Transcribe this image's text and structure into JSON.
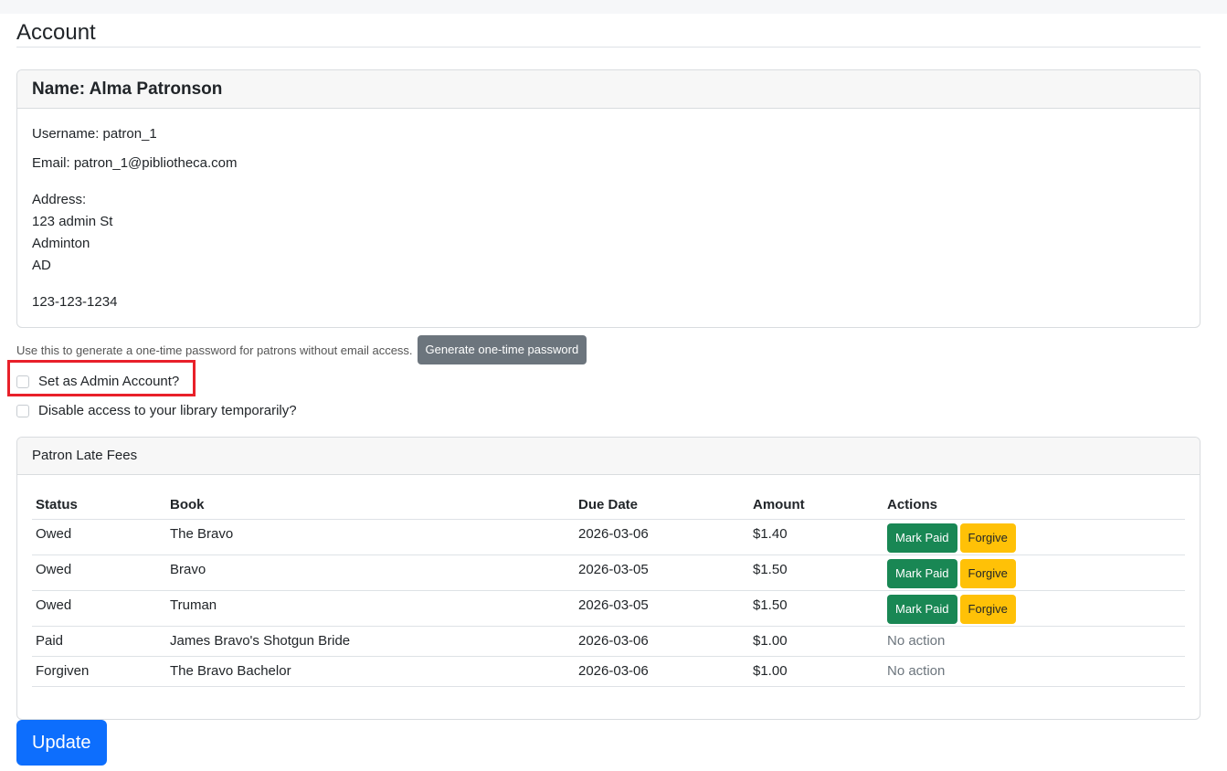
{
  "page": {
    "title": "Account"
  },
  "profile": {
    "name_line": "Name: Alma Patronson",
    "username_line": "Username: patron_1",
    "email_line": "Email: patron_1@pibliotheca.com",
    "address_label": "Address:",
    "address_street": "123 admin St",
    "address_city": "Adminton",
    "address_state": "AD",
    "phone": "123-123-1234"
  },
  "otp": {
    "description": "Use this to generate a one-time password for patrons without email access.",
    "button_label": "Generate one-time password"
  },
  "options": {
    "admin_label": "Set as Admin Account?",
    "admin_checked": false,
    "disable_label": "Disable access to your library temporarily?",
    "disable_checked": false
  },
  "colors": {
    "highlight": "#e8202a",
    "primary": "#0d6efd",
    "success": "#198754",
    "warning": "#ffc107",
    "secondary": "#6c757d"
  },
  "fees": {
    "header": "Patron Late Fees",
    "columns": [
      "Status",
      "Book",
      "Due Date",
      "Amount",
      "Actions"
    ],
    "rows": [
      {
        "status": "Owed",
        "book": "The Bravo",
        "due": "2026-03-06",
        "amount": "$1.40",
        "actions": [
          "Mark Paid",
          "Forgive"
        ]
      },
      {
        "status": "Owed",
        "book": "Bravo",
        "due": "2026-03-05",
        "amount": "$1.50",
        "actions": [
          "Mark Paid",
          "Forgive"
        ]
      },
      {
        "status": "Owed",
        "book": "Truman",
        "due": "2026-03-05",
        "amount": "$1.50",
        "actions": [
          "Mark Paid",
          "Forgive"
        ]
      },
      {
        "status": "Paid",
        "book": "James Bravo's Shotgun Bride",
        "due": "2026-03-06",
        "amount": "$1.00",
        "no_action": "No action"
      },
      {
        "status": "Forgiven",
        "book": "The Bravo Bachelor",
        "due": "2026-03-06",
        "amount": "$1.00",
        "no_action": "No action"
      }
    ]
  },
  "update_button": "Update"
}
